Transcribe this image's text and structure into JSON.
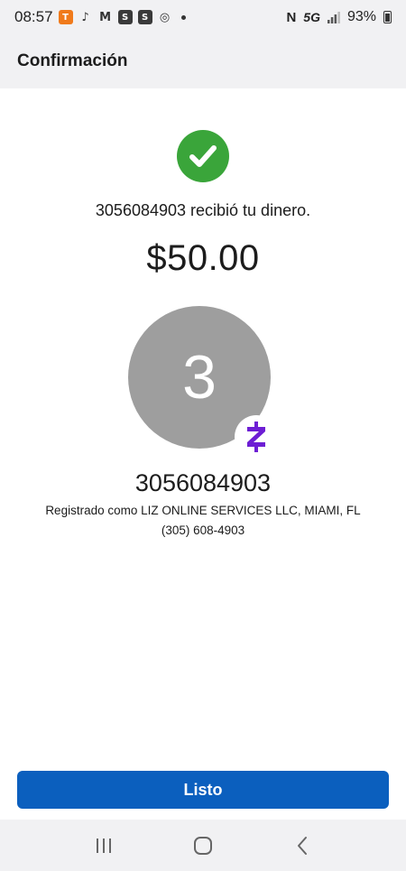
{
  "status_bar": {
    "time": "08:57",
    "network": "5G",
    "battery": "93%",
    "notification_icons": [
      "temu-icon",
      "tiktok-icon",
      "gmail-icon",
      "s-app-icon",
      "s-app-icon",
      "chrome-icon"
    ]
  },
  "header": {
    "title": "Confirmación"
  },
  "confirmation": {
    "message": "3056084903 recibió tu dinero.",
    "amount": "$50.00",
    "avatar_initial": "3",
    "recipient": "3056084903",
    "registered_as": "Registrado como LIZ ONLINE SERVICES LLC, MIAMI, FL",
    "phone": "(305) 608-4903"
  },
  "actions": {
    "done_label": "Listo"
  },
  "colors": {
    "success": "#3aa53a",
    "primary": "#0b5fbe",
    "zelle": "#6d1ed4",
    "avatar": "#9e9e9e"
  }
}
